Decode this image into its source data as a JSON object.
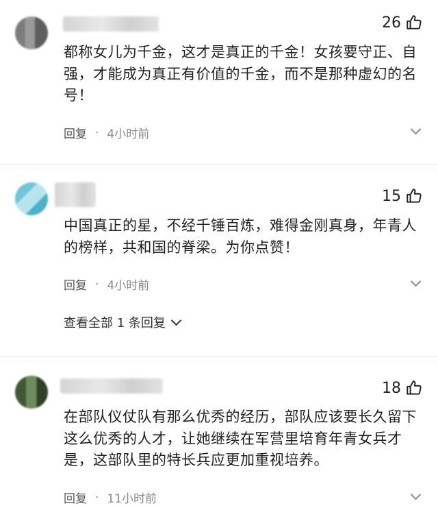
{
  "comments": [
    {
      "likes": "26",
      "text": "都称女儿为千金，这才是真正的千金！女孩要守正、自强，才能成为真正有价值的千金，而不是那种虚幻的名号！",
      "reply_label": "回复",
      "separator": "·",
      "time": "4小时前"
    },
    {
      "likes": "15",
      "text": "中国真正的星，不经千锤百炼，难得金刚真身，年青人的榜样，共和国的脊梁。为你点赞！",
      "reply_label": "回复",
      "separator": "·",
      "time": "4小时前",
      "view_replies": "查看全部 1 条回复"
    },
    {
      "likes": "18",
      "text": "在部队仪仗队有那么优秀的经历，部队应该要长久留下这么优秀的人才，让她继续在军营里培育年青女兵才是，这部队里的特长兵应更加重视培养。",
      "reply_label": "回复",
      "separator": "·",
      "time": "11小时前"
    }
  ],
  "icons": {
    "like": "thumbs-up-icon",
    "more": "chevron-down-icon"
  }
}
